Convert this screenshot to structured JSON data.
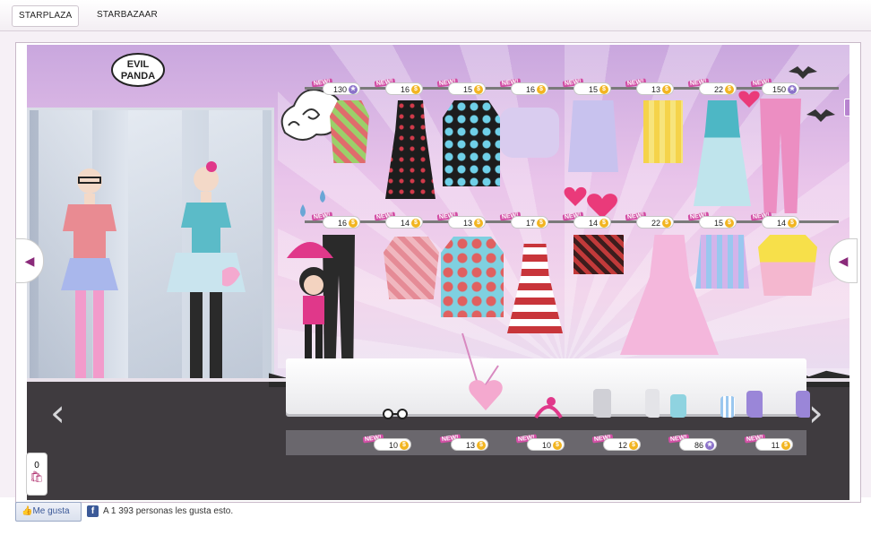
{
  "tabs": [
    {
      "label": "STARPLAZA"
    },
    {
      "label": "STARBAZAAR"
    }
  ],
  "logo": {
    "text_line1": "EVIL",
    "text_line2": "PANDA"
  },
  "help": {
    "label": "?"
  },
  "new_badge": "NEW!",
  "rail_top": {
    "prices": [
      {
        "value": "130",
        "currency": "star"
      },
      {
        "value": "16",
        "currency": "coin"
      },
      {
        "value": "15",
        "currency": "coin"
      },
      {
        "value": "16",
        "currency": "coin"
      },
      {
        "value": "15",
        "currency": "coin"
      },
      {
        "value": "13",
        "currency": "coin"
      },
      {
        "value": "22",
        "currency": "coin"
      },
      {
        "value": "150",
        "currency": "star"
      }
    ]
  },
  "rail_bottom": {
    "prices": [
      {
        "value": "16",
        "currency": "coin"
      },
      {
        "value": "14",
        "currency": "coin"
      },
      {
        "value": "13",
        "currency": "coin"
      },
      {
        "value": "17",
        "currency": "coin"
      },
      {
        "value": "14",
        "currency": "coin"
      },
      {
        "value": "22",
        "currency": "coin"
      },
      {
        "value": "15",
        "currency": "coin"
      },
      {
        "value": "14",
        "currency": "coin"
      }
    ]
  },
  "shelf": {
    "prices": [
      {
        "value": "10",
        "currency": "coin"
      },
      {
        "value": "13",
        "currency": "coin"
      },
      {
        "value": "10",
        "currency": "coin"
      },
      {
        "value": "12",
        "currency": "coin"
      },
      {
        "value": "86",
        "currency": "star"
      },
      {
        "value": "11",
        "currency": "coin"
      }
    ]
  },
  "counter": {
    "value": "0"
  },
  "facebook": {
    "like_button": "Me gusta",
    "icon_letter": "f",
    "like_text": "A 1 393 personas les gusta esto."
  },
  "colors": {
    "accent_pink": "#d24fa5",
    "coin": "#f2b521",
    "star_currency": "#8b72c9",
    "fb_blue": "#3b5998"
  }
}
